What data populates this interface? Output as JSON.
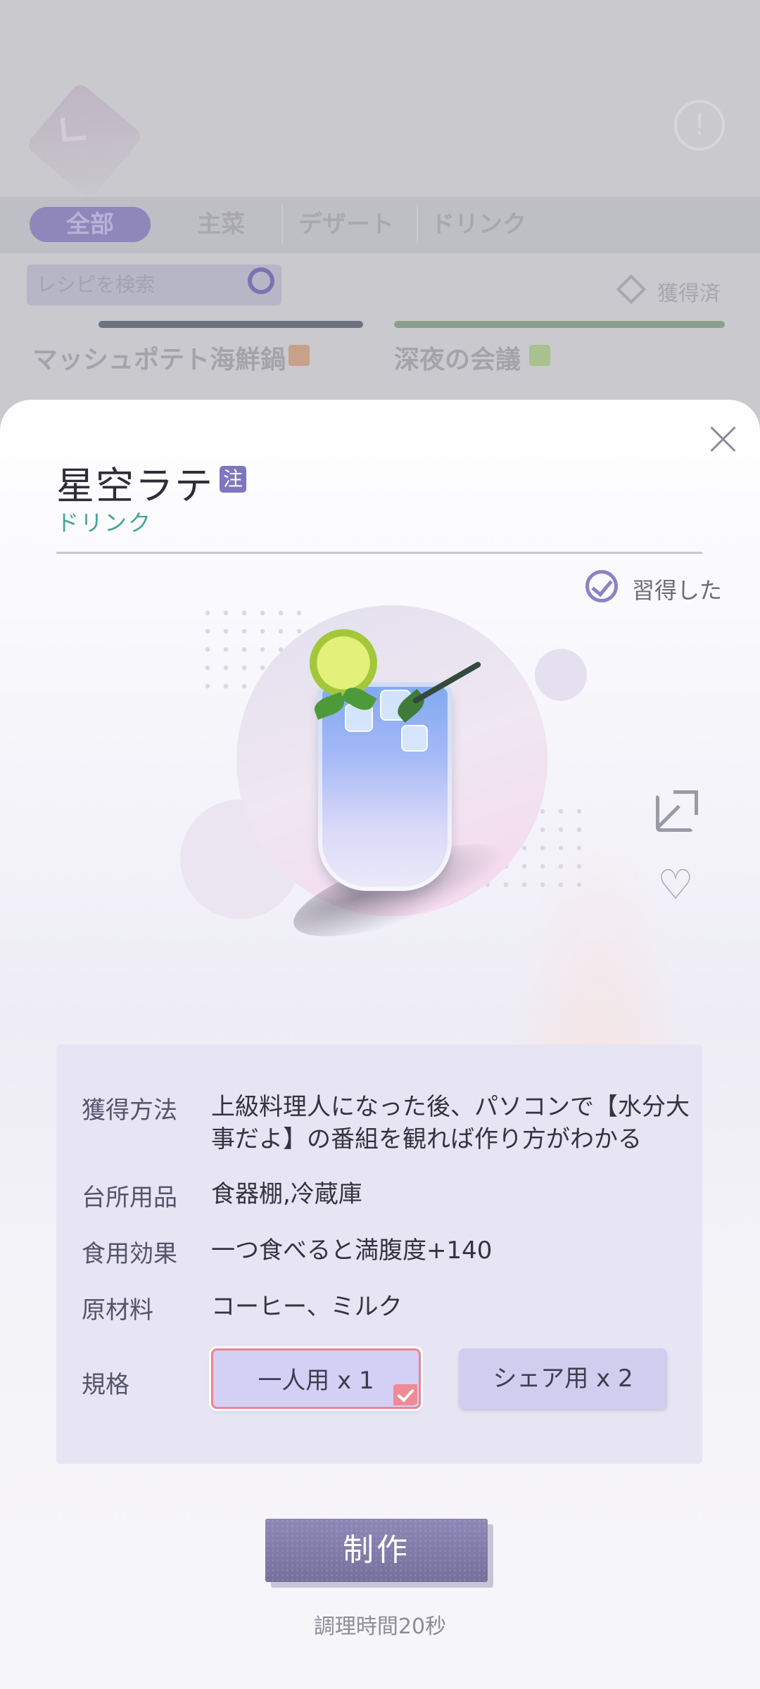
{
  "background": {
    "tabs": [
      "全部",
      "主菜",
      "デザート",
      "ドリンク"
    ],
    "search_placeholder": "レシピを検索",
    "sort_label": "獲得済",
    "cards": [
      "マッシュポテト海鮮鍋",
      "深夜の会議"
    ]
  },
  "modal": {
    "title": "星空ラテ",
    "note_badge": "注",
    "category": "ドリンク",
    "learned_label": "習得した",
    "rows": [
      {
        "label": "獲得方法",
        "value": "上級料理人になった後、パソコンで【水分大事だよ】の番組を観れば作り方がわかる"
      },
      {
        "label": "台所用品",
        "value": "食器棚,冷蔵庫"
      },
      {
        "label": "食用効果",
        "value": "一つ食べると満腹度+140"
      },
      {
        "label": "原材料",
        "value": "コーヒー、ミルク"
      }
    ],
    "spec": {
      "label": "規格",
      "options": [
        "一人用 x 1",
        "シェア用 x 2"
      ],
      "selected_index": 0
    },
    "make_button": "制作",
    "cook_time": "調理時間20秒",
    "colors": {
      "accent": "#7d77bf",
      "category": "#48a59a",
      "selected_border": "#e9868f"
    },
    "icons": [
      "close-icon",
      "check-circle-icon",
      "share-icon",
      "heart-icon",
      "checkmark-icon"
    ]
  }
}
